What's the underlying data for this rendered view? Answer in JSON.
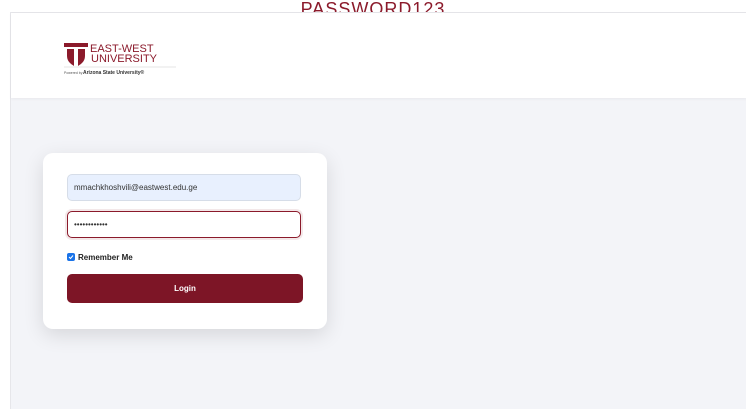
{
  "caption": {
    "text": "PASSWORD123"
  },
  "header": {
    "logo": {
      "icon": "east-west-university-shield-icon",
      "line1": "EAST-WEST",
      "line2": "UNIVERSITY",
      "tagline_prefix": "Powered by",
      "tagline": "Arizona State University®"
    }
  },
  "login": {
    "email_value": "mmachkhoshvili@eastwest.edu.ge",
    "password_value": "••••••••••••",
    "remember": {
      "label": "Remember Me",
      "checked": true
    },
    "button_label": "Login"
  },
  "colors": {
    "brand": "#7d1526",
    "caption": "#8b1a2b",
    "page_bg": "#f3f4f8",
    "email_bg": "#e8f0fe",
    "checkbox": "#1a73e8"
  }
}
